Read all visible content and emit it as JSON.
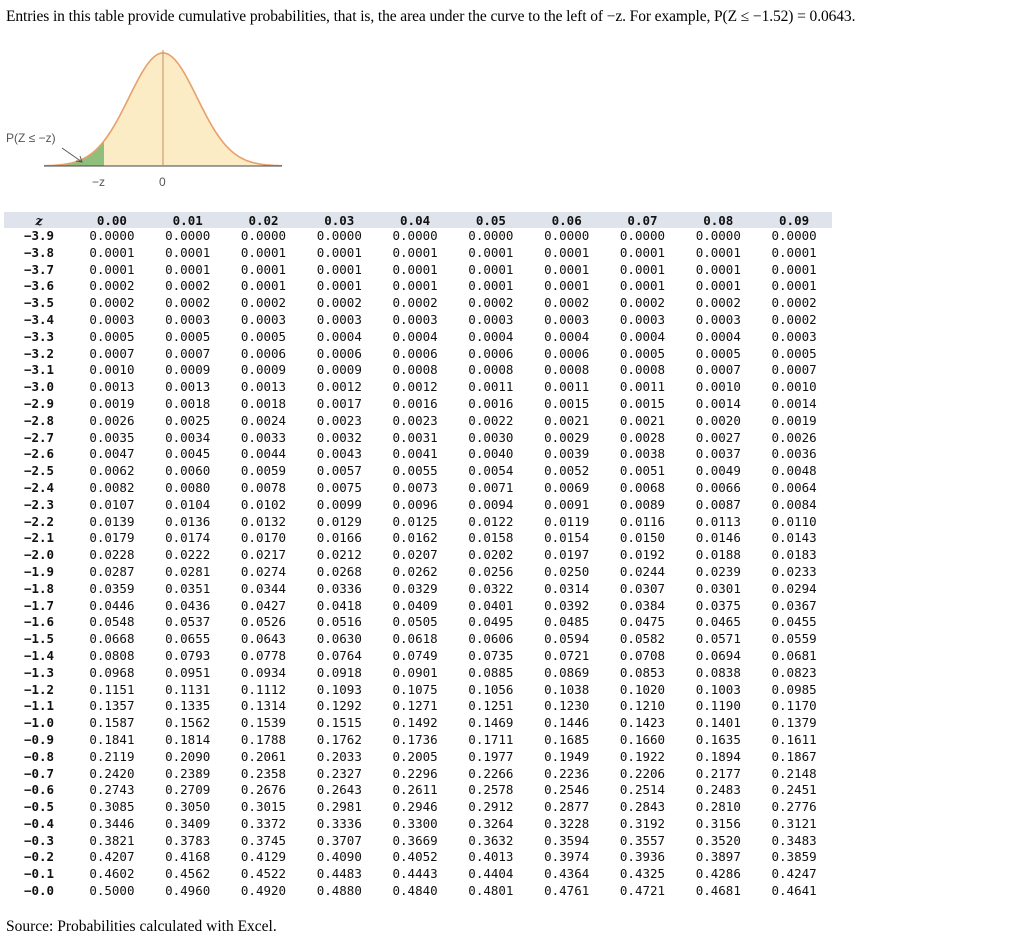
{
  "intro": {
    "text": "Entries in this table provide cumulative probabilities, that is, the area under the curve to the left of −z. For example, P(Z ≤ −1.52) = 0.0643."
  },
  "figure": {
    "area_label": "P(Z ≤ −z)",
    "tick_neg_z": "−z",
    "tick_zero": "0",
    "colors": {
      "curve": "#e8a06a",
      "left_fill": "#8fbf7a",
      "body_fill": "#fbecc6"
    }
  },
  "table": {
    "z_header": "z",
    "columns": [
      "0.00",
      "0.01",
      "0.02",
      "0.03",
      "0.04",
      "0.05",
      "0.06",
      "0.07",
      "0.08",
      "0.09"
    ],
    "rows": [
      {
        "z": "−3.9",
        "v": [
          "0.0000",
          "0.0000",
          "0.0000",
          "0.0000",
          "0.0000",
          "0.0000",
          "0.0000",
          "0.0000",
          "0.0000",
          "0.0000"
        ]
      },
      {
        "z": "−3.8",
        "v": [
          "0.0001",
          "0.0001",
          "0.0001",
          "0.0001",
          "0.0001",
          "0.0001",
          "0.0001",
          "0.0001",
          "0.0001",
          "0.0001"
        ]
      },
      {
        "z": "−3.7",
        "v": [
          "0.0001",
          "0.0001",
          "0.0001",
          "0.0001",
          "0.0001",
          "0.0001",
          "0.0001",
          "0.0001",
          "0.0001",
          "0.0001"
        ]
      },
      {
        "z": "−3.6",
        "v": [
          "0.0002",
          "0.0002",
          "0.0001",
          "0.0001",
          "0.0001",
          "0.0001",
          "0.0001",
          "0.0001",
          "0.0001",
          "0.0001"
        ]
      },
      {
        "z": "−3.5",
        "v": [
          "0.0002",
          "0.0002",
          "0.0002",
          "0.0002",
          "0.0002",
          "0.0002",
          "0.0002",
          "0.0002",
          "0.0002",
          "0.0002"
        ]
      },
      {
        "z": "−3.4",
        "v": [
          "0.0003",
          "0.0003",
          "0.0003",
          "0.0003",
          "0.0003",
          "0.0003",
          "0.0003",
          "0.0003",
          "0.0003",
          "0.0002"
        ]
      },
      {
        "z": "−3.3",
        "v": [
          "0.0005",
          "0.0005",
          "0.0005",
          "0.0004",
          "0.0004",
          "0.0004",
          "0.0004",
          "0.0004",
          "0.0004",
          "0.0003"
        ]
      },
      {
        "z": "−3.2",
        "v": [
          "0.0007",
          "0.0007",
          "0.0006",
          "0.0006",
          "0.0006",
          "0.0006",
          "0.0006",
          "0.0005",
          "0.0005",
          "0.0005"
        ]
      },
      {
        "z": "−3.1",
        "v": [
          "0.0010",
          "0.0009",
          "0.0009",
          "0.0009",
          "0.0008",
          "0.0008",
          "0.0008",
          "0.0008",
          "0.0007",
          "0.0007"
        ]
      },
      {
        "z": "−3.0",
        "v": [
          "0.0013",
          "0.0013",
          "0.0013",
          "0.0012",
          "0.0012",
          "0.0011",
          "0.0011",
          "0.0011",
          "0.0010",
          "0.0010"
        ]
      },
      {
        "z": "−2.9",
        "v": [
          "0.0019",
          "0.0018",
          "0.0018",
          "0.0017",
          "0.0016",
          "0.0016",
          "0.0015",
          "0.0015",
          "0.0014",
          "0.0014"
        ]
      },
      {
        "z": "−2.8",
        "v": [
          "0.0026",
          "0.0025",
          "0.0024",
          "0.0023",
          "0.0023",
          "0.0022",
          "0.0021",
          "0.0021",
          "0.0020",
          "0.0019"
        ]
      },
      {
        "z": "−2.7",
        "v": [
          "0.0035",
          "0.0034",
          "0.0033",
          "0.0032",
          "0.0031",
          "0.0030",
          "0.0029",
          "0.0028",
          "0.0027",
          "0.0026"
        ]
      },
      {
        "z": "−2.6",
        "v": [
          "0.0047",
          "0.0045",
          "0.0044",
          "0.0043",
          "0.0041",
          "0.0040",
          "0.0039",
          "0.0038",
          "0.0037",
          "0.0036"
        ]
      },
      {
        "z": "−2.5",
        "v": [
          "0.0062",
          "0.0060",
          "0.0059",
          "0.0057",
          "0.0055",
          "0.0054",
          "0.0052",
          "0.0051",
          "0.0049",
          "0.0048"
        ]
      },
      {
        "z": "−2.4",
        "v": [
          "0.0082",
          "0.0080",
          "0.0078",
          "0.0075",
          "0.0073",
          "0.0071",
          "0.0069",
          "0.0068",
          "0.0066",
          "0.0064"
        ]
      },
      {
        "z": "−2.3",
        "v": [
          "0.0107",
          "0.0104",
          "0.0102",
          "0.0099",
          "0.0096",
          "0.0094",
          "0.0091",
          "0.0089",
          "0.0087",
          "0.0084"
        ]
      },
      {
        "z": "−2.2",
        "v": [
          "0.0139",
          "0.0136",
          "0.0132",
          "0.0129",
          "0.0125",
          "0.0122",
          "0.0119",
          "0.0116",
          "0.0113",
          "0.0110"
        ]
      },
      {
        "z": "−2.1",
        "v": [
          "0.0179",
          "0.0174",
          "0.0170",
          "0.0166",
          "0.0162",
          "0.0158",
          "0.0154",
          "0.0150",
          "0.0146",
          "0.0143"
        ]
      },
      {
        "z": "−2.0",
        "v": [
          "0.0228",
          "0.0222",
          "0.0217",
          "0.0212",
          "0.0207",
          "0.0202",
          "0.0197",
          "0.0192",
          "0.0188",
          "0.0183"
        ]
      },
      {
        "z": "−1.9",
        "v": [
          "0.0287",
          "0.0281",
          "0.0274",
          "0.0268",
          "0.0262",
          "0.0256",
          "0.0250",
          "0.0244",
          "0.0239",
          "0.0233"
        ]
      },
      {
        "z": "−1.8",
        "v": [
          "0.0359",
          "0.0351",
          "0.0344",
          "0.0336",
          "0.0329",
          "0.0322",
          "0.0314",
          "0.0307",
          "0.0301",
          "0.0294"
        ]
      },
      {
        "z": "−1.7",
        "v": [
          "0.0446",
          "0.0436",
          "0.0427",
          "0.0418",
          "0.0409",
          "0.0401",
          "0.0392",
          "0.0384",
          "0.0375",
          "0.0367"
        ]
      },
      {
        "z": "−1.6",
        "v": [
          "0.0548",
          "0.0537",
          "0.0526",
          "0.0516",
          "0.0505",
          "0.0495",
          "0.0485",
          "0.0475",
          "0.0465",
          "0.0455"
        ]
      },
      {
        "z": "−1.5",
        "v": [
          "0.0668",
          "0.0655",
          "0.0643",
          "0.0630",
          "0.0618",
          "0.0606",
          "0.0594",
          "0.0582",
          "0.0571",
          "0.0559"
        ]
      },
      {
        "z": "−1.4",
        "v": [
          "0.0808",
          "0.0793",
          "0.0778",
          "0.0764",
          "0.0749",
          "0.0735",
          "0.0721",
          "0.0708",
          "0.0694",
          "0.0681"
        ]
      },
      {
        "z": "−1.3",
        "v": [
          "0.0968",
          "0.0951",
          "0.0934",
          "0.0918",
          "0.0901",
          "0.0885",
          "0.0869",
          "0.0853",
          "0.0838",
          "0.0823"
        ]
      },
      {
        "z": "−1.2",
        "v": [
          "0.1151",
          "0.1131",
          "0.1112",
          "0.1093",
          "0.1075",
          "0.1056",
          "0.1038",
          "0.1020",
          "0.1003",
          "0.0985"
        ]
      },
      {
        "z": "−1.1",
        "v": [
          "0.1357",
          "0.1335",
          "0.1314",
          "0.1292",
          "0.1271",
          "0.1251",
          "0.1230",
          "0.1210",
          "0.1190",
          "0.1170"
        ]
      },
      {
        "z": "−1.0",
        "v": [
          "0.1587",
          "0.1562",
          "0.1539",
          "0.1515",
          "0.1492",
          "0.1469",
          "0.1446",
          "0.1423",
          "0.1401",
          "0.1379"
        ]
      },
      {
        "z": "−0.9",
        "v": [
          "0.1841",
          "0.1814",
          "0.1788",
          "0.1762",
          "0.1736",
          "0.1711",
          "0.1685",
          "0.1660",
          "0.1635",
          "0.1611"
        ]
      },
      {
        "z": "−0.8",
        "v": [
          "0.2119",
          "0.2090",
          "0.2061",
          "0.2033",
          "0.2005",
          "0.1977",
          "0.1949",
          "0.1922",
          "0.1894",
          "0.1867"
        ]
      },
      {
        "z": "−0.7",
        "v": [
          "0.2420",
          "0.2389",
          "0.2358",
          "0.2327",
          "0.2296",
          "0.2266",
          "0.2236",
          "0.2206",
          "0.2177",
          "0.2148"
        ]
      },
      {
        "z": "−0.6",
        "v": [
          "0.2743",
          "0.2709",
          "0.2676",
          "0.2643",
          "0.2611",
          "0.2578",
          "0.2546",
          "0.2514",
          "0.2483",
          "0.2451"
        ]
      },
      {
        "z": "−0.5",
        "v": [
          "0.3085",
          "0.3050",
          "0.3015",
          "0.2981",
          "0.2946",
          "0.2912",
          "0.2877",
          "0.2843",
          "0.2810",
          "0.2776"
        ]
      },
      {
        "z": "−0.4",
        "v": [
          "0.3446",
          "0.3409",
          "0.3372",
          "0.3336",
          "0.3300",
          "0.3264",
          "0.3228",
          "0.3192",
          "0.3156",
          "0.3121"
        ]
      },
      {
        "z": "−0.3",
        "v": [
          "0.3821",
          "0.3783",
          "0.3745",
          "0.3707",
          "0.3669",
          "0.3632",
          "0.3594",
          "0.3557",
          "0.3520",
          "0.3483"
        ]
      },
      {
        "z": "−0.2",
        "v": [
          "0.4207",
          "0.4168",
          "0.4129",
          "0.4090",
          "0.4052",
          "0.4013",
          "0.3974",
          "0.3936",
          "0.3897",
          "0.3859"
        ]
      },
      {
        "z": "−0.1",
        "v": [
          "0.4602",
          "0.4562",
          "0.4522",
          "0.4483",
          "0.4443",
          "0.4404",
          "0.4364",
          "0.4325",
          "0.4286",
          "0.4247"
        ]
      },
      {
        "z": "−0.0",
        "v": [
          "0.5000",
          "0.4960",
          "0.4920",
          "0.4880",
          "0.4840",
          "0.4801",
          "0.4761",
          "0.4721",
          "0.4681",
          "0.4641"
        ]
      }
    ]
  },
  "source": "Source: Probabilities calculated with Excel."
}
